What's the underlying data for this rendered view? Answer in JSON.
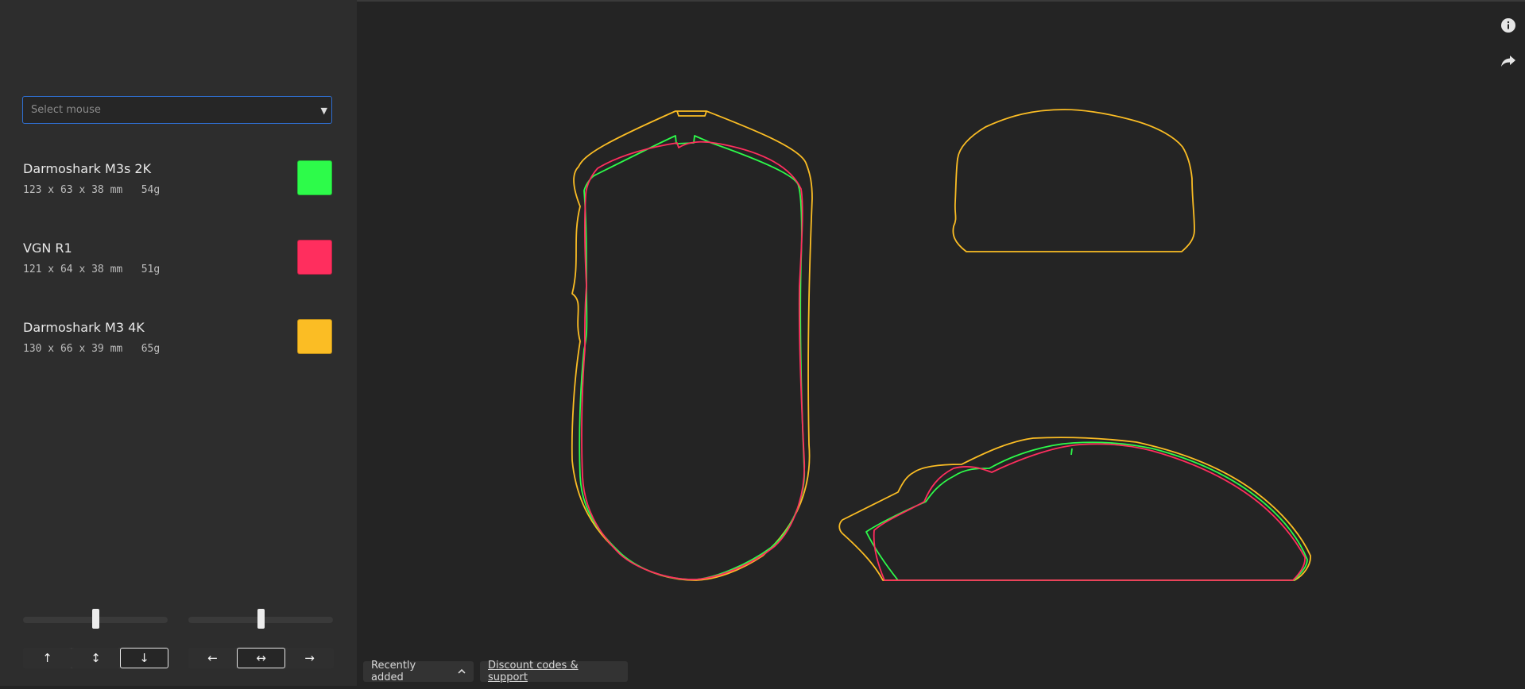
{
  "sidebar": {
    "select": {
      "placeholder": "Select mouse"
    },
    "mice": [
      {
        "name": "Darmoshark M3s 2K",
        "dims": "123 x 63 x 38 mm",
        "weight": "54g",
        "color": "#2dfb4a"
      },
      {
        "name": "VGN R1",
        "dims": "121 x 64 x 38 mm",
        "weight": "51g",
        "color": "#ff2e5e"
      },
      {
        "name": "Darmoshark M3 4K",
        "dims": "130 x 66 x 39 mm",
        "weight": "65g",
        "color": "#fbbd24"
      }
    ],
    "vertical_slider": {
      "value_percent": 50
    },
    "horizontal_slider": {
      "value_percent": 50
    },
    "vertical_align_buttons": [
      {
        "icon": "arrow-up-icon",
        "glyph": "↑",
        "active": false
      },
      {
        "icon": "arrows-vertical-icon",
        "glyph": "↕",
        "active": false
      },
      {
        "icon": "arrow-down-icon",
        "glyph": "↓",
        "active": true
      }
    ],
    "horizontal_align_buttons": [
      {
        "icon": "arrow-left-icon",
        "glyph": "←",
        "active": false
      },
      {
        "icon": "arrows-horizontal-icon",
        "glyph": "↔",
        "active": true
      },
      {
        "icon": "arrow-right-icon",
        "glyph": "→",
        "active": false
      }
    ]
  },
  "toolbar_right": {
    "info_icon": "info-icon",
    "share_icon": "share-icon"
  },
  "footer": {
    "recently_added": "Recently added",
    "discount": "Discount codes & support"
  }
}
